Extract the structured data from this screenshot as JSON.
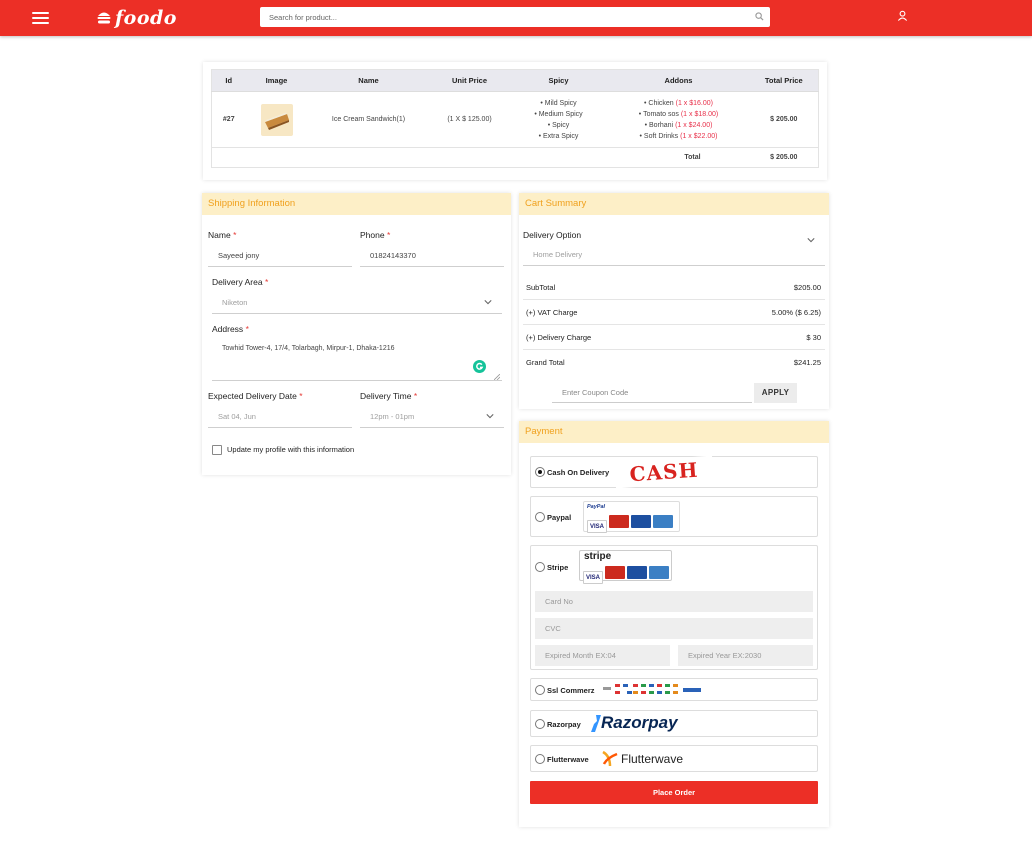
{
  "header": {
    "logo_text": "foodo",
    "search_placeholder": "Search for product...",
    "icons": [
      "menu-icon",
      "search-icon",
      "user-icon"
    ]
  },
  "order_table": {
    "columns": [
      "Id",
      "Image",
      "Name",
      "Unit Price",
      "Spicy",
      "Addons",
      "Total Price"
    ],
    "row": {
      "id": "#27",
      "name": "Ice Cream Sandwich(1)",
      "unit_price": "(1 X $ 125.00)",
      "spicy": [
        "Mild Spicy",
        "Medium Spicy",
        "Spicy",
        "Extra Spicy"
      ],
      "addons": [
        {
          "name": "Chicken",
          "price": "(1 x $16.00)"
        },
        {
          "name": "Tomato sos",
          "price": "(1 x $18.00)"
        },
        {
          "name": "Borhani",
          "price": "(1 x $24.00)"
        },
        {
          "name": "Soft Drinks",
          "price": "(1 x $22.00)"
        }
      ],
      "total": "$ 205.00"
    },
    "total_label": "Total",
    "total_value": "$ 205.00"
  },
  "shipping": {
    "title": "Shipping Information",
    "name_label": "Name",
    "name_value": "Sayeed jony",
    "phone_label": "Phone",
    "phone_value": "01824143370",
    "area_label": "Delivery Area",
    "area_value": "Niketon",
    "address_label": "Address",
    "address_value": "Towhid Tower-4, 17/4, Tolarbagh, Mirpur-1, Dhaka-1216",
    "date_label": "Expected Delivery Date",
    "date_value": "Sat 04, Jun",
    "time_label": "Delivery Time",
    "time_value": "12pm - 01pm",
    "update_label": "Update my profile with this information",
    "required_mark": "*"
  },
  "cart": {
    "title": "Cart Summary",
    "option_label": "Delivery Option",
    "option_value": "Home Delivery",
    "rows": [
      {
        "label": "SubTotal",
        "value": "$205.00"
      },
      {
        "label": "(+) VAT Charge",
        "value": "5.00% ($ 6.25)"
      },
      {
        "label": "(+) Delivery Charge",
        "value": "$ 30"
      },
      {
        "label": "Grand Total",
        "value": "$241.25"
      }
    ],
    "coupon_placeholder": "Enter Coupon Code",
    "apply_label": "APPLY"
  },
  "payment": {
    "title": "Payment",
    "options": [
      {
        "name": "Cash On Delivery",
        "selected": true
      },
      {
        "name": "Paypal",
        "selected": false
      },
      {
        "name": "Stripe",
        "selected": false
      },
      {
        "name": "Ssl Commerz",
        "selected": false
      },
      {
        "name": "Razorpay",
        "selected": false
      },
      {
        "name": "Flutterwave",
        "selected": false
      }
    ],
    "cash_logo": "CASH",
    "paypal_logo": "PayPal",
    "stripe_logo": "stripe",
    "razorpay_logo": "Razorpay",
    "flutterwave_logo": "Flutterwave",
    "card_visa": "VISA",
    "card_no_placeholder": "Card No",
    "cvc_placeholder": "CVC",
    "exp_month_placeholder": "Expired Month EX:04",
    "exp_year_placeholder": "Expired Year EX:2030",
    "place_order_label": "Place Order"
  },
  "colors": {
    "brand_red": "#ec2f26",
    "section_header_bg": "#fdefc7",
    "section_header_text": "#f0a11e",
    "price_red": "#e8304a"
  }
}
